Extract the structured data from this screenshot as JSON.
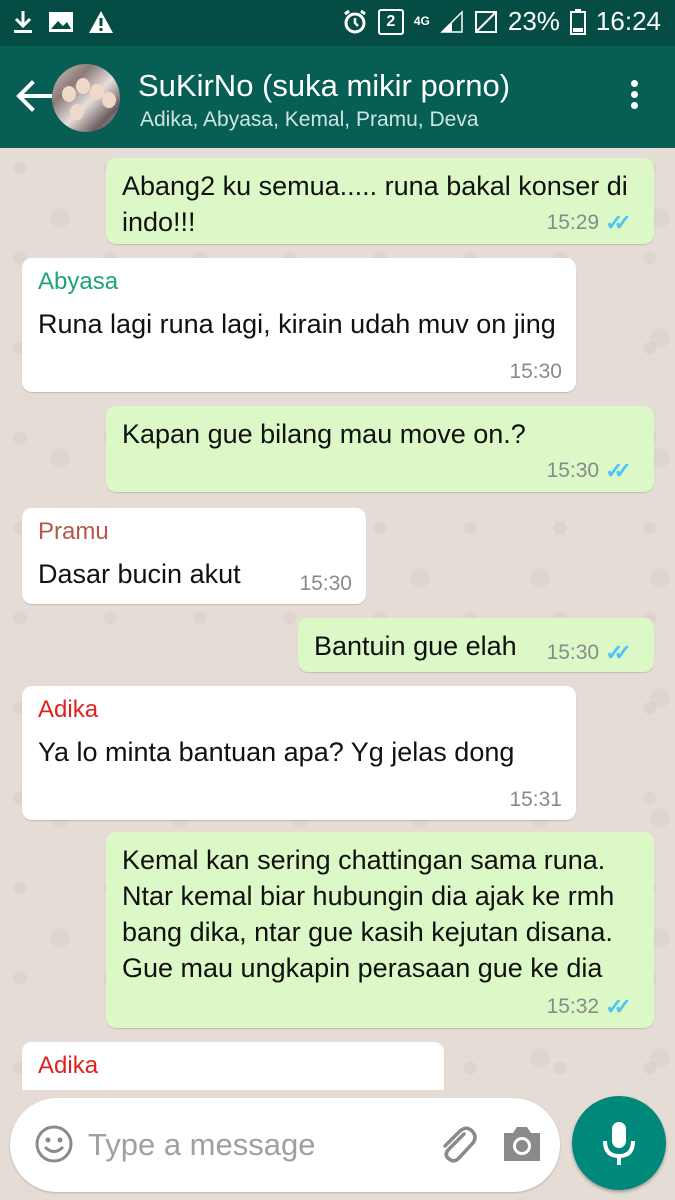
{
  "status_bar": {
    "badge": "2",
    "network": "4G",
    "battery": "23%",
    "time": "16:24",
    "icons": [
      "download-icon",
      "image-icon",
      "warning-icon",
      "alarm-icon",
      "signal-icon",
      "no-signal-icon",
      "battery-icon"
    ]
  },
  "header": {
    "title": "SuKirNo (suka mikir porno)",
    "members": "Adika, Abyasa, Kemal, Pramu, Deva"
  },
  "messages": [
    {
      "direction": "out",
      "text": "Abang2 ku semua..... runa bakal konser di indo!!!",
      "time": "15:29",
      "read": true
    },
    {
      "direction": "in",
      "sender": "Abyasa",
      "sender_color": "#1fa37a",
      "text": "Runa lagi runa lagi, kirain udah muv on jing",
      "time": "15:30"
    },
    {
      "direction": "out",
      "text": "Kapan gue bilang mau move on.?",
      "time": "15:30",
      "read": true
    },
    {
      "direction": "in",
      "sender": "Pramu",
      "sender_color": "#b5574a",
      "text": "Dasar bucin akut",
      "time": "15:30"
    },
    {
      "direction": "out",
      "text": "Bantuin gue elah",
      "time": "15:30",
      "read": true
    },
    {
      "direction": "in",
      "sender": "Adika",
      "sender_color": "#e0221f",
      "text": "Ya lo minta bantuan apa? Yg jelas dong",
      "time": "15:31"
    },
    {
      "direction": "out",
      "text": "Kemal kan sering chattingan sama runa. Ntar kemal biar hubungin dia ajak ke rmh bang dika, ntar gue kasih kejutan disana. Gue mau ungkapin perasaan gue ke dia",
      "time": "15:32",
      "read": true
    },
    {
      "direction": "in",
      "sender": "Adika",
      "sender_color": "#e0221f",
      "text": "",
      "time": ""
    }
  ],
  "composer": {
    "placeholder": "Type a message"
  },
  "colors": {
    "header": "#075e54",
    "status_bar": "#054d44",
    "outgoing_bubble": "#dcf8c6",
    "incoming_bubble": "#ffffff",
    "mic_button": "#00897b",
    "read_ticks": "#4fc3f7"
  }
}
